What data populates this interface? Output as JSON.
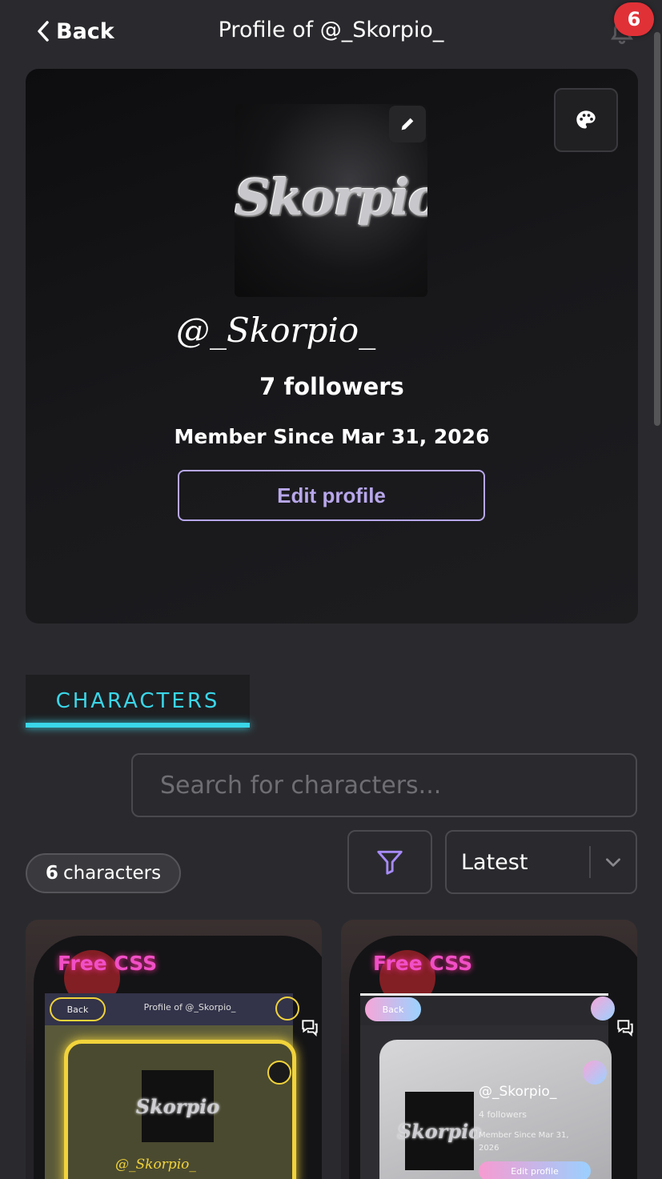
{
  "header": {
    "back_label": "Back",
    "title": "Profile of @_Skorpio_",
    "notification_count": "6"
  },
  "profile": {
    "avatar_text": "Skorpio",
    "username": "@_Skorpio_",
    "followers": "7 followers",
    "member_since": "Member Since Mar 31, 2026",
    "edit_profile_label": "Edit profile"
  },
  "tabs": [
    {
      "label": "CHARACTERS",
      "active": true
    }
  ],
  "search": {
    "placeholder": "Search for characters..."
  },
  "list": {
    "count_number": "6",
    "count_label": "characters",
    "sort_value": "Latest"
  },
  "cards": [
    {
      "tag": "Free CSS",
      "mini_back": "Back",
      "mini_title": "Profile of @_Skorpio_",
      "mini_avatar": "Skorpio",
      "mini_username": "@_Skorpio_"
    },
    {
      "tag": "Free CSS",
      "mini_back": "Back",
      "mini_avatar": "Skorpio",
      "mini_username": "@_Skorpio_",
      "mini_followers": "4 followers",
      "mini_member_since": "Member Since Mar 31, 2026",
      "mini_edit": "Edit profile"
    }
  ],
  "colors": {
    "background": "#2a2a2e",
    "accent_tab": "#3ad6e8",
    "edit_profile": "#b8a7ea",
    "badge": "#e03137",
    "filter_icon": "#a78bfa",
    "free_css": "#f04fc6"
  },
  "icons": {
    "back": "chevron-left-icon",
    "notifications": "bell-icon",
    "avatar_edit": "pencil-icon",
    "theme": "palette-icon",
    "filter": "funnel-icon",
    "sort": "chevron-down-icon",
    "card_chat": "chat-bubble-icon"
  }
}
